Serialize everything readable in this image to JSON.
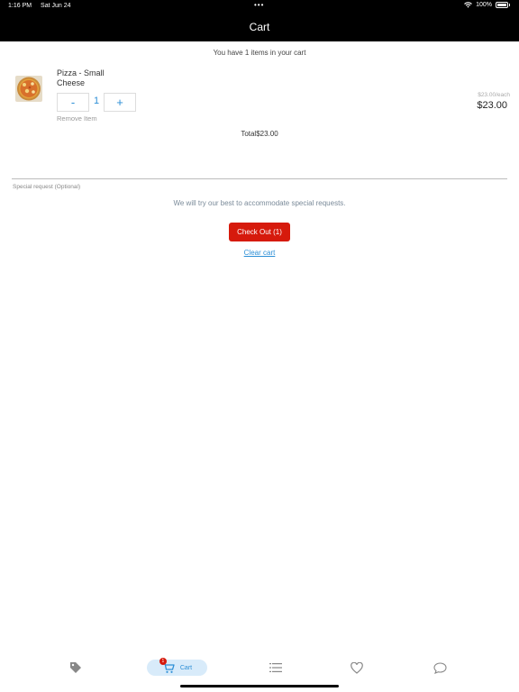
{
  "status_bar": {
    "time": "1:16 PM",
    "date": "Sat Jun 24",
    "dots": "•••",
    "battery_percent": "100%",
    "icons": [
      "wifi-icon",
      "battery-icon"
    ]
  },
  "nav": {
    "title": "Cart"
  },
  "cart": {
    "summary": "You have 1 items in your cart",
    "items": [
      {
        "name": "Pizza - Small Cheese",
        "quantity": "1",
        "minus_label": "-",
        "plus_label": "+",
        "remove_label": "Remove Item",
        "unit_price": "$23.00/each",
        "line_total": "$23.00",
        "thumbnail_icon": "pizza-photo"
      }
    ],
    "total_text": "Total$23.00"
  },
  "special_request": {
    "label": "Special request (Optional)",
    "note": "We will try our best to accommodate special requests."
  },
  "actions": {
    "checkout_label": "Check Out (1)",
    "clear_label": "Clear cart"
  },
  "tab_bar": {
    "tabs": [
      {
        "icon": "tag-icon",
        "label": ""
      },
      {
        "icon": "cart-icon",
        "label": "Cart",
        "badge": "1",
        "active": true
      },
      {
        "icon": "list-icon",
        "label": ""
      },
      {
        "icon": "heart-icon",
        "label": ""
      },
      {
        "icon": "chat-bubble-icon",
        "label": ""
      }
    ]
  },
  "colors": {
    "header_bg": "#000000",
    "accent_blue": "#2d8fd6",
    "checkout_red": "#d61a0c",
    "active_tab_bg": "#d8ebfa"
  }
}
